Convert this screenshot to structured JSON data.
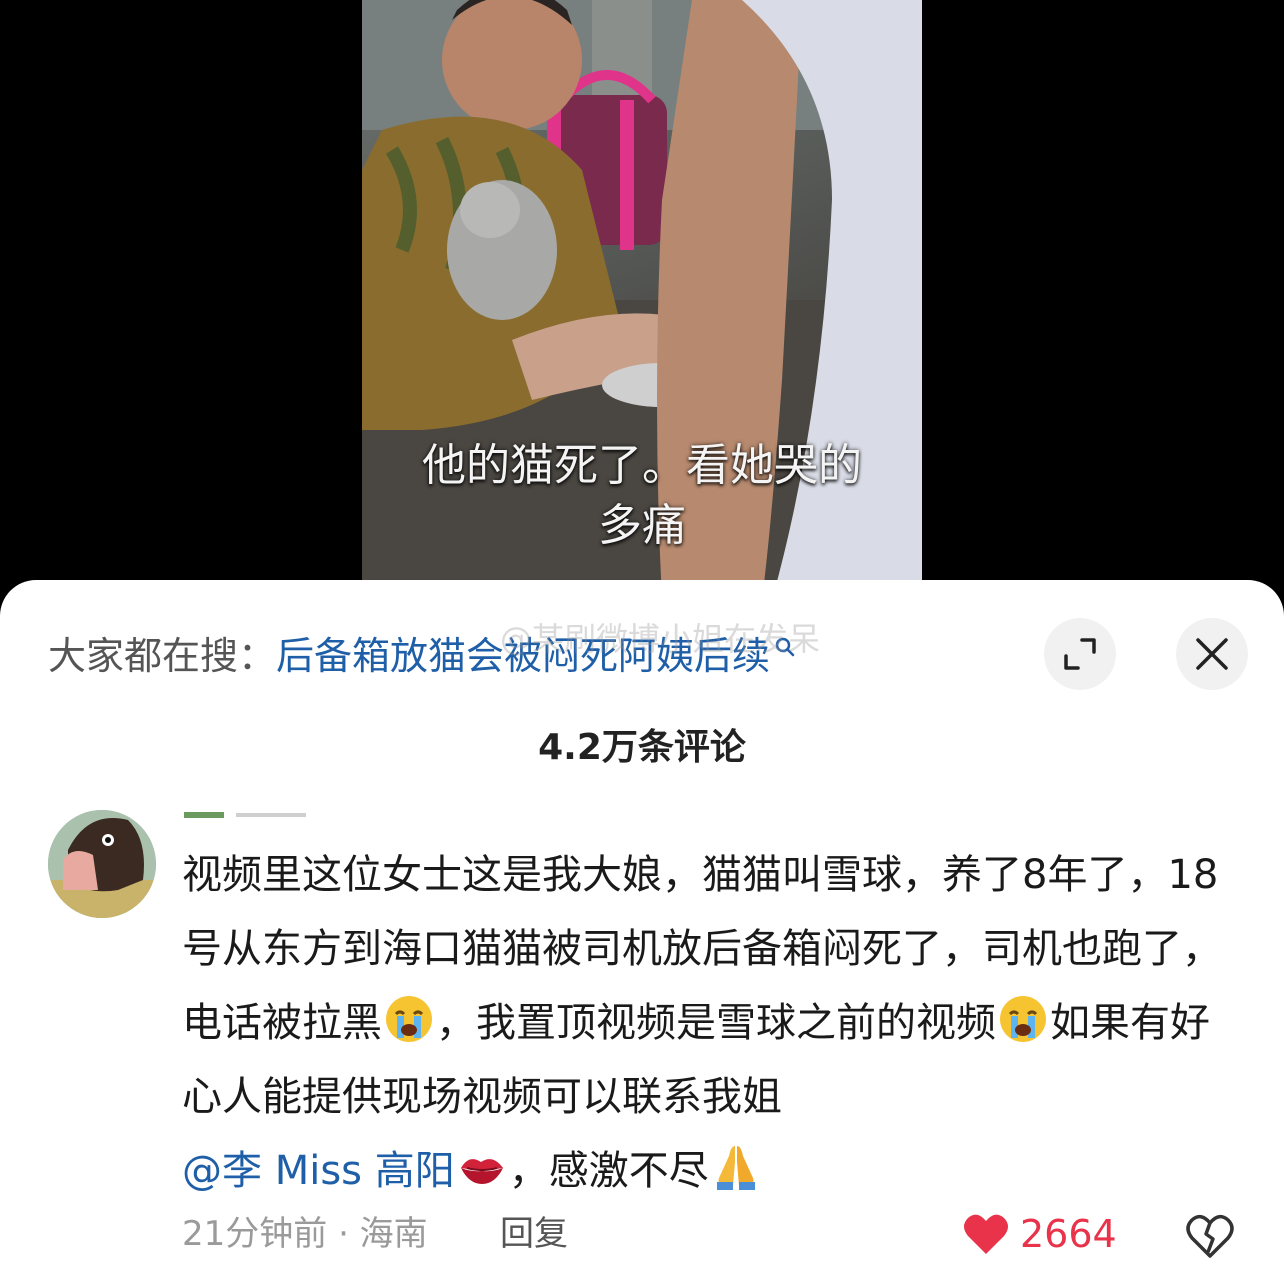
{
  "video": {
    "subtitle_line1": "他的猫死了。看她哭的",
    "subtitle_line2": "多痛"
  },
  "sheet": {
    "search_prefix": "大家都在搜：",
    "search_term": "后备箱放猫会被闷死阿姨后续",
    "watermark": "@某刷微博小姐在发呆",
    "expand_icon": "expand-icon",
    "close_icon": "close-icon",
    "comment_count": "4.2万条评论"
  },
  "comment": {
    "text_part1": "视频里这位女士这是我大娘，猫猫叫雪球，养了8年了，18号从东方到海口猫猫被司机放后备箱闷死了，司机也跑了，电话被拉黑",
    "text_part2": "，我置顶视频是雪球之前的视频",
    "text_part3": "如果有好心人能提供现场视频可以联系我姐",
    "mention": "@李 Miss 高阳",
    "text_part4": "，感激不尽",
    "emoji_cry": "loudly-crying-face-emoji",
    "emoji_kiss": "kiss-mark-emoji",
    "emoji_pray": "folded-hands-emoji",
    "time_location": "21分钟前 · 海南",
    "reply_label": "回复",
    "like_count": "2664",
    "like_color": "#e8334a",
    "mention_color": "#1f5fa8"
  }
}
